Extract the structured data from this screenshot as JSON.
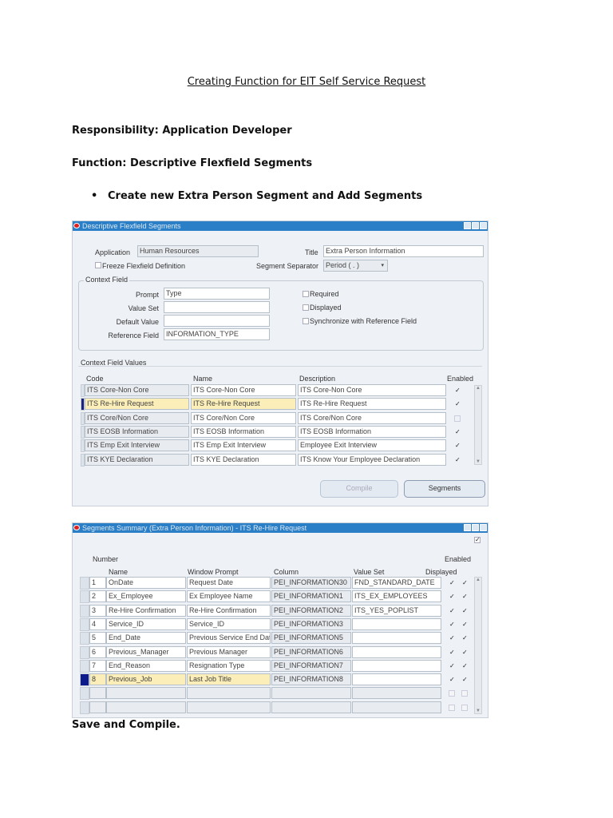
{
  "doc": {
    "title": "Creating Function for EIT Self Service Request",
    "responsibility": "Responsibility: Application Developer",
    "function": "Function: Descriptive Flexfield Segments",
    "bullet": "Create new Extra Person Segment and Add Segments",
    "footer": "Save and Compile."
  },
  "win1": {
    "title": "Descriptive Flexfield Segments",
    "application_label": "Application",
    "application": "Human Resources",
    "title_label": "Title",
    "title_value": "Extra Person Information",
    "freeze_label": "Freeze Flexfield Definition",
    "separator_label": "Segment Separator",
    "separator": "Period ( . )",
    "context_label": "Context Field",
    "prompt_label": "Prompt",
    "prompt": "Type",
    "valueset_label": "Value Set",
    "valueset": "",
    "default_label": "Default Value",
    "default": "",
    "ref_label": "Reference Field",
    "ref": "INFORMATION_TYPE",
    "required_label": "Required",
    "displayed_label": "Displayed",
    "sync_label": "Synchronize with Reference Field",
    "cfv_label": "Context Field Values",
    "headers": [
      "Code",
      "Name",
      "Description",
      "Enabled"
    ],
    "rows": [
      {
        "code": "ITS Core-Non Core",
        "name": "ITS Core-Non Core",
        "desc": "ITS Core-Non Core",
        "enabled": true
      },
      {
        "code": "ITS Re-Hire Request",
        "name": "ITS Re-Hire Request",
        "desc": "ITS Re-Hire Request",
        "enabled": true,
        "selected": true
      },
      {
        "code": "ITS Core/Non Core",
        "name": "ITS Core/Non Core",
        "desc": "ITS Core/Non Core",
        "enabled": false
      },
      {
        "code": "ITS EOSB Information",
        "name": "ITS EOSB Information",
        "desc": "ITS EOSB Information",
        "enabled": true
      },
      {
        "code": "ITS Emp Exit Interview",
        "name": "ITS Emp Exit Interview",
        "desc": "Employee Exit Interview",
        "enabled": true
      },
      {
        "code": "ITS KYE Declaration",
        "name": "ITS KYE Declaration",
        "desc": "ITS Know Your Employee Declaration",
        "enabled": true
      }
    ],
    "compile": "Compile",
    "segments": "Segments"
  },
  "win2": {
    "title": "Segments Summary (Extra Person Information) - ITS Re-Hire Request",
    "number_label": "Number",
    "enabled_label": "Enabled",
    "headers": [
      "Name",
      "Window Prompt",
      "Column",
      "Value Set",
      "Displayed"
    ],
    "rows": [
      {
        "num": "1",
        "name": "OnDate",
        "prompt": "Request Date",
        "column": "PEI_INFORMATION30",
        "vs": "FND_STANDARD_DATE",
        "d": true,
        "e": true
      },
      {
        "num": "2",
        "name": "Ex_Employee",
        "prompt": "Ex Employee Name",
        "column": "PEI_INFORMATION1",
        "vs": "ITS_EX_EMPLOYEES",
        "d": true,
        "e": true
      },
      {
        "num": "3",
        "name": "Re-Hire Confirmation",
        "prompt": "Re-Hire Confirmation",
        "column": "PEI_INFORMATION2",
        "vs": "ITS_YES_POPLIST",
        "d": true,
        "e": true
      },
      {
        "num": "4",
        "name": "Service_ID",
        "prompt": "Service_ID",
        "column": "PEI_INFORMATION3",
        "vs": "",
        "d": true,
        "e": true
      },
      {
        "num": "5",
        "name": "End_Date",
        "prompt": "Previous Service End Date",
        "column": "PEI_INFORMATION5",
        "vs": "",
        "d": true,
        "e": true
      },
      {
        "num": "6",
        "name": "Previous_Manager",
        "prompt": "Previous Manager",
        "column": "PEI_INFORMATION6",
        "vs": "",
        "d": true,
        "e": true
      },
      {
        "num": "7",
        "name": "End_Reason",
        "prompt": "Resignation Type",
        "column": "PEI_INFORMATION7",
        "vs": "",
        "d": true,
        "e": true
      },
      {
        "num": "8",
        "name": "Previous_Job",
        "prompt": "Last Job Title",
        "column": "PEI_INFORMATION8",
        "vs": "",
        "d": true,
        "e": true,
        "selected": true
      },
      {
        "num": "",
        "name": "",
        "prompt": "",
        "column": "",
        "vs": "",
        "d": false,
        "e": false
      },
      {
        "num": "",
        "name": "",
        "prompt": "",
        "column": "",
        "vs": "",
        "d": false,
        "e": false
      }
    ]
  }
}
